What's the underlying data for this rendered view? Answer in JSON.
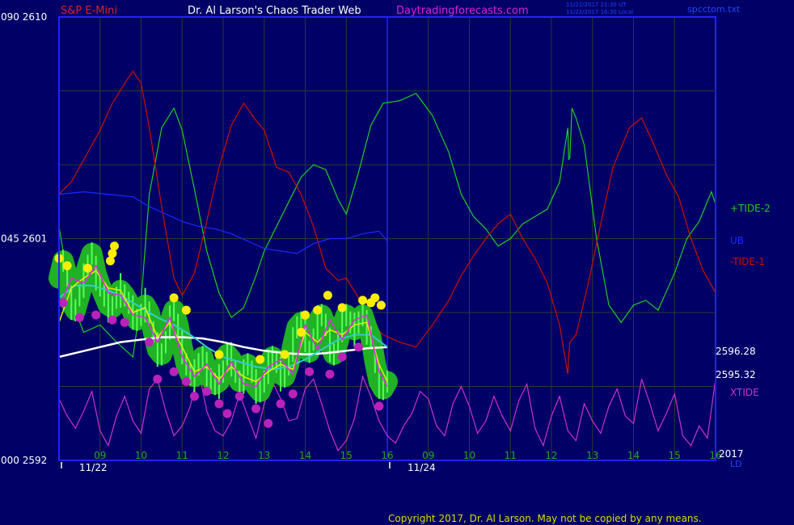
{
  "header": {
    "instrument": "S&P E-Mini",
    "author": "Dr. Al Larson's Chaos Trader Web",
    "site": "Daytradingforecasts.com",
    "timestamp_1": "11/22/2017 21:30 UT",
    "timestamp_2": "11/22/2017 16:30 Local",
    "filename": "spcctom.txt"
  },
  "footer": {
    "copyright": "Copyright 2017, Dr. Al Larson. May not be copied by any means."
  },
  "colors": {
    "background": "#000066",
    "frame": "#2222ff",
    "grid": "#2d3a2d",
    "tide_plus2": "#22cc22",
    "tide_minus1": "#cc1100",
    "ub": "#1a2aff",
    "xtide": "#cc33cc",
    "price_fill": "#22bb22",
    "price_bar": "#55ff55",
    "ma_white": "#ffffff",
    "ma_cyan": "#33cccc",
    "ma_yellow": "#eeee00",
    "ma_magenta": "#ee22ee",
    "highs_marker": "#ffee00",
    "lows_marker": "#bb22bb"
  },
  "chart_data": {
    "type": "line",
    "y_axis": {
      "labels": [
        {
          "value": 2610,
          "text": "090  2610"
        },
        {
          "value": 2601,
          "text": "045  2601"
        },
        {
          "value": 2592,
          "text": "000  2592"
        }
      ],
      "ylim": [
        2592,
        2610
      ]
    },
    "x_axis": {
      "hour_labels": [
        "09",
        "10",
        "11",
        "12",
        "13",
        "14",
        "15",
        "16",
        "09",
        "10",
        "11",
        "12",
        "13",
        "14",
        "15",
        "16"
      ],
      "date_labels": [
        "11/22",
        "11/24"
      ],
      "xlim": [
        0,
        16
      ]
    },
    "legend": [
      {
        "text": "+TIDE-2",
        "color_key": "tide_plus2"
      },
      {
        "text": "UB",
        "color_key": "ub"
      },
      {
        "text": "-TIDE-1",
        "color_key": "tide_minus1"
      },
      {
        "text": "XTIDE",
        "color_key": "xtide"
      }
    ],
    "value_labels": [
      "2596.28",
      "2595.32"
    ],
    "right_edge_labels": [
      "2017",
      "LD"
    ],
    "series": [
      {
        "name": "+TIDE-2",
        "x": [
          0,
          0.3,
          0.6,
          1,
          1.4,
          1.8,
          2,
          2.2,
          2.5,
          2.8,
          3,
          3.3,
          3.6,
          3.9,
          4.2,
          4.5,
          4.8,
          5,
          5.3,
          5.6,
          5.9,
          6.2,
          6.5,
          6.8,
          7,
          7.3,
          7.6,
          7.9,
          8.3,
          8.7,
          9.1,
          9.5,
          9.8,
          10.1,
          10.4,
          10.7,
          11,
          11.3,
          11.6,
          11.9,
          12.2,
          12.4,
          12.42,
          12.45,
          12.5,
          12.6,
          12.8,
          13.1,
          13.4,
          13.7,
          14,
          14.3,
          14.6,
          15,
          15.3,
          15.6,
          15.9,
          16
        ],
        "y": [
          2601.5,
          2598.5,
          2597.2,
          2597.5,
          2596.8,
          2596.2,
          2598.5,
          2602.8,
          2605.5,
          2606.3,
          2605.4,
          2603,
          2600.5,
          2598.8,
          2597.8,
          2598.2,
          2599.5,
          2600.5,
          2601.5,
          2602.5,
          2603.5,
          2604,
          2603.8,
          2602.6,
          2602,
          2603.7,
          2605.6,
          2606.5,
          2606.6,
          2606.9,
          2606,
          2604.5,
          2602.8,
          2601.9,
          2601.4,
          2600.7,
          2601,
          2601.6,
          2601.9,
          2602.2,
          2603.3,
          2605.5,
          2604.2,
          2604.3,
          2606.3,
          2605.9,
          2604.8,
          2601,
          2598.3,
          2597.6,
          2598.3,
          2598.5,
          2598.1,
          2599.6,
          2601,
          2601.7,
          2602.9,
          2602.4
        ]
      },
      {
        "name": "-TIDE-1",
        "x": [
          0,
          0.3,
          0.6,
          1,
          1.3,
          1.6,
          1.8,
          2,
          2.2,
          2.5,
          2.8,
          3,
          3.3,
          3.6,
          3.9,
          4.2,
          4.5,
          4.8,
          5,
          5.3,
          5.6,
          5.9,
          6.2,
          6.5,
          6.8,
          7,
          7.3,
          7.6,
          7.9,
          8.3,
          8.7,
          9.1,
          9.5,
          9.8,
          10.1,
          10.4,
          10.7,
          11,
          11.3,
          11.6,
          11.9,
          12.2,
          12.4,
          12.42,
          12.45,
          12.6,
          12.9,
          13.2,
          13.5,
          13.9,
          14.2,
          14.5,
          14.8,
          15.1,
          15.4,
          15.7,
          16
        ],
        "y": [
          2602.8,
          2603.3,
          2604.2,
          2605.4,
          2606.5,
          2607.3,
          2607.8,
          2607.3,
          2605.5,
          2602.3,
          2599.4,
          2598.7,
          2599.6,
          2601.7,
          2603.9,
          2605.6,
          2606.5,
          2605.8,
          2605.4,
          2603.9,
          2603.7,
          2602.8,
          2601.5,
          2599.8,
          2599.3,
          2599.4,
          2598.6,
          2597.6,
          2597.1,
          2596.8,
          2596.6,
          2597.5,
          2598.5,
          2599.5,
          2600.3,
          2601,
          2601.6,
          2602,
          2601,
          2600.2,
          2599.2,
          2597.5,
          2595.5,
          2596.2,
          2596.8,
          2597.1,
          2599.2,
          2601.6,
          2603.9,
          2605.5,
          2605.9,
          2604.8,
          2603.6,
          2602.7,
          2601,
          2599.7,
          2598.8
        ]
      },
      {
        "name": "UB",
        "x": [
          0,
          0.6,
          1.2,
          1.8,
          2.2,
          2.6,
          3,
          3.4,
          3.8,
          4.2,
          4.6,
          5,
          5.4,
          5.8,
          6.2,
          6.6,
          7,
          7.4,
          7.8,
          8
        ],
        "y": [
          2602.8,
          2602.9,
          2602.8,
          2602.7,
          2602.3,
          2602,
          2601.7,
          2601.5,
          2601.4,
          2601.2,
          2600.9,
          2600.6,
          2600.5,
          2600.4,
          2600.8,
          2601,
          2601,
          2601.2,
          2601.3,
          2600.9
        ]
      },
      {
        "name": "XTIDE",
        "x": [
          0,
          0.2,
          0.4,
          0.6,
          0.8,
          1,
          1.2,
          1.4,
          1.6,
          1.8,
          2,
          2.2,
          2.4,
          2.6,
          2.8,
          3,
          3.2,
          3.4,
          3.6,
          3.8,
          4,
          4.2,
          4.4,
          4.6,
          4.8,
          5,
          5.2,
          5.4,
          5.6,
          5.8,
          6,
          6.2,
          6.4,
          6.6,
          6.8,
          7,
          7.2,
          7.4,
          7.6,
          7.8,
          8,
          8.2,
          8.4,
          8.6,
          8.8,
          9,
          9.2,
          9.4,
          9.6,
          9.8,
          10,
          10.2,
          10.4,
          10.6,
          10.8,
          11,
          11.2,
          11.4,
          11.6,
          11.8,
          12,
          12.2,
          12.4,
          12.6,
          12.8,
          13,
          13.2,
          13.4,
          13.6,
          13.8,
          14,
          14.2,
          14.4,
          14.6,
          14.8,
          15,
          15.2,
          15.4,
          15.6,
          15.8,
          16
        ],
        "y": [
          2594.5,
          2593.8,
          2593.3,
          2594,
          2594.8,
          2593.2,
          2592.6,
          2593.8,
          2594.6,
          2593.6,
          2593.1,
          2594.9,
          2595.3,
          2594,
          2593,
          2593.4,
          2594.2,
          2595.7,
          2594,
          2593.2,
          2593,
          2593.6,
          2594.7,
          2593.8,
          2592.9,
          2594.3,
          2595.2,
          2594.5,
          2593.6,
          2593.7,
          2594.9,
          2595.3,
          2594.3,
          2593.2,
          2592.4,
          2592.8,
          2593.7,
          2595.4,
          2594.6,
          2593.6,
          2593,
          2592.7,
          2593.4,
          2593.9,
          2594.8,
          2594.5,
          2593.4,
          2593,
          2594.3,
          2595,
          2594.2,
          2593.1,
          2593.6,
          2594.6,
          2593.8,
          2593.2,
          2594.4,
          2595.1,
          2593.3,
          2592.6,
          2593.8,
          2594.6,
          2593.2,
          2592.8,
          2594.3,
          2593.6,
          2593.1,
          2594.2,
          2594.9,
          2593.8,
          2593.5,
          2595.3,
          2594.3,
          2593.2,
          2593.9,
          2594.7,
          2593,
          2592.6,
          2593.4,
          2592.9,
          2595.3
        ]
      }
    ],
    "price": {
      "x": [
        0,
        0.1,
        0.2,
        0.3,
        0.4,
        0.5,
        0.6,
        0.7,
        0.8,
        0.9,
        1,
        1.1,
        1.2,
        1.3,
        1.4,
        1.5,
        1.6,
        1.7,
        1.8,
        1.9,
        2,
        2.1,
        2.2,
        2.3,
        2.4,
        2.5,
        2.6,
        2.7,
        2.8,
        2.9,
        3,
        3.1,
        3.2,
        3.3,
        3.4,
        3.5,
        3.6,
        3.7,
        3.8,
        3.9,
        4,
        4.1,
        4.2,
        4.3,
        4.4,
        4.5,
        4.6,
        4.7,
        4.8,
        4.9,
        5,
        5.1,
        5.2,
        5.3,
        5.4,
        5.5,
        5.6,
        5.7,
        5.8,
        5.9,
        6,
        6.1,
        6.2,
        6.3,
        6.4,
        6.5,
        6.6,
        6.7,
        6.8,
        6.9,
        7,
        7.1,
        7.2,
        7.3,
        7.4,
        7.5,
        7.6,
        7.7,
        7.8,
        7.9,
        8
      ],
      "y": [
        2599.4,
        2600.1,
        2599.5,
        2598.4,
        2598.1,
        2598.7,
        2599.3,
        2599.9,
        2600.4,
        2599.6,
        2599.1,
        2598.7,
        2598.3,
        2598.2,
        2598.6,
        2598.9,
        2598.7,
        2598.4,
        2598,
        2597.7,
        2597.9,
        2598.3,
        2598,
        2597.2,
        2596.5,
        2596.3,
        2596.8,
        2597.6,
        2598.1,
        2597.5,
        2596.6,
        2595.9,
        2595.5,
        2595.4,
        2595.9,
        2596.2,
        2595.7,
        2595.3,
        2595.1,
        2595.2,
        2595.6,
        2596.3,
        2596.1,
        2595.6,
        2595.2,
        2595.4,
        2595.9,
        2595.6,
        2595,
        2594.8,
        2595.2,
        2595.8,
        2596.2,
        2596,
        2595.5,
        2595.4,
        2595.9,
        2596.7,
        2597.4,
        2597.6,
        2597.1,
        2596.4,
        2596.9,
        2597.6,
        2597.9,
        2597.5,
        2596.7,
        2596.3,
        2596.8,
        2597.5,
        2597.9,
        2597.6,
        2597.3,
        2597.6,
        2597.9,
        2597.4,
        2597,
        2596,
        2595.2,
        2594.9,
        2595.2
      ]
    },
    "moving_averages": [
      {
        "x": [
          0,
          0.5,
          1,
          1.5,
          2,
          2.5,
          3,
          3.5,
          4,
          4.5,
          5,
          5.5,
          6,
          6.5,
          7,
          7.5,
          8
        ],
        "y": [
          2596.2,
          2596.4,
          2596.6,
          2596.8,
          2596.9,
          2597,
          2597,
          2596.95,
          2596.8,
          2596.6,
          2596.45,
          2596.35,
          2596.3,
          2596.35,
          2596.45,
          2596.55,
          2596.6
        ]
      },
      {
        "x": [
          0,
          0.4,
          0.8,
          1.2,
          1.6,
          2,
          2.4,
          2.8,
          3.2,
          3.6,
          4,
          4.4,
          4.8,
          5.2,
          5.6,
          6,
          6.4,
          6.8,
          7.2,
          7.6,
          8
        ],
        "y": [
          2598.6,
          2599.1,
          2599.1,
          2598.9,
          2598.6,
          2598.2,
          2597.8,
          2597.5,
          2597.1,
          2596.6,
          2596.2,
          2596,
          2595.8,
          2595.7,
          2595.8,
          2596.1,
          2596.5,
          2596.9,
          2597.1,
          2597.1,
          2596.6
        ]
      },
      {
        "x": [
          0,
          0.3,
          0.6,
          0.9,
          1.2,
          1.5,
          1.8,
          2.1,
          2.4,
          2.7,
          3,
          3.3,
          3.6,
          3.9,
          4.2,
          4.5,
          4.8,
          5.1,
          5.4,
          5.7,
          6,
          6.3,
          6.6,
          6.9,
          7.2,
          7.5,
          7.8,
          8
        ],
        "y": [
          2597.6,
          2599,
          2599.4,
          2599.7,
          2599,
          2598.9,
          2598,
          2598.2,
          2597,
          2597.6,
          2596.6,
          2595.6,
          2595.8,
          2595.3,
          2595.8,
          2595.4,
          2595.2,
          2595.6,
          2595.9,
          2595.7,
          2597.2,
          2596.8,
          2597.3,
          2597.1,
          2597.5,
          2597.6,
          2595.9,
          2595.2
        ]
      },
      {
        "x": [
          0,
          0.3,
          0.6,
          0.9,
          1.2,
          1.5,
          1.8,
          2.1,
          2.4,
          2.7,
          3,
          3.3,
          3.6,
          3.9,
          4.2,
          4.5,
          4.8,
          5.1,
          5.4,
          5.7,
          6,
          6.3,
          6.6,
          6.9,
          7.2,
          7.5,
          7.8,
          8
        ],
        "y": [
          2598.2,
          2599.4,
          2599.2,
          2599.9,
          2598.8,
          2598.7,
          2597.9,
          2597.8,
          2596.8,
          2597.8,
          2596.2,
          2595.4,
          2595.9,
          2595.1,
          2596,
          2595.1,
          2595,
          2595.8,
          2596.1,
          2595.5,
          2597.5,
          2596.5,
          2597.7,
          2596.9,
          2597.7,
          2597.9,
          2595.6,
          2595
        ]
      }
    ],
    "highs": [
      [
        0,
        2600.2
      ],
      [
        0.2,
        2599.9
      ],
      [
        0.7,
        2599.8
      ],
      [
        1.25,
        2600.1
      ],
      [
        1.35,
        2600.7
      ],
      [
        1.3,
        2600.4
      ],
      [
        2.8,
        2598.6
      ],
      [
        3.1,
        2598.1
      ],
      [
        3.9,
        2596.3
      ],
      [
        4.9,
        2596.1
      ],
      [
        5.5,
        2596.3
      ],
      [
        5.9,
        2597.2
      ],
      [
        6.0,
        2597.9
      ],
      [
        6.3,
        2598.1
      ],
      [
        6.55,
        2598.7
      ],
      [
        6.9,
        2598.2
      ],
      [
        7.4,
        2598.5
      ],
      [
        7.6,
        2598.4
      ],
      [
        7.7,
        2598.6
      ],
      [
        7.85,
        2598.3
      ]
    ],
    "lows": [
      [
        0.1,
        2598.4
      ],
      [
        0.5,
        2597.8
      ],
      [
        0.9,
        2597.9
      ],
      [
        1.3,
        2597.7
      ],
      [
        1.6,
        2597.6
      ],
      [
        2.2,
        2596.8
      ],
      [
        2.4,
        2595.3
      ],
      [
        2.8,
        2595.6
      ],
      [
        3.1,
        2595.2
      ],
      [
        3.3,
        2594.6
      ],
      [
        3.6,
        2594.8
      ],
      [
        3.9,
        2594.3
      ],
      [
        4.1,
        2593.9
      ],
      [
        4.4,
        2594.6
      ],
      [
        4.8,
        2594.1
      ],
      [
        5.1,
        2593.5
      ],
      [
        5.4,
        2594.3
      ],
      [
        5.7,
        2594.7
      ],
      [
        6.1,
        2595.6
      ],
      [
        6.6,
        2595.5
      ],
      [
        6.9,
        2596.2
      ],
      [
        7.3,
        2596.6
      ],
      [
        7.8,
        2594.2
      ]
    ]
  }
}
